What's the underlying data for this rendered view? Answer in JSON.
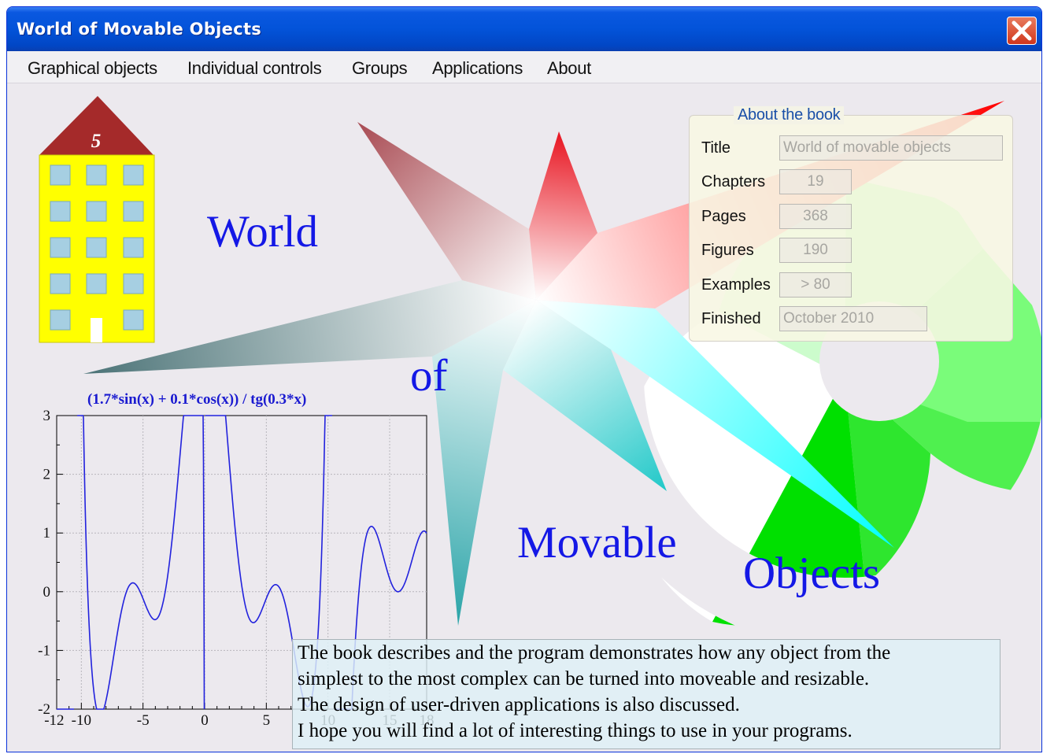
{
  "window": {
    "title": "World of Movable Objects"
  },
  "menu": [
    "Graphical objects",
    "Individual controls",
    "Groups",
    "Applications",
    "About"
  ],
  "building": {
    "floor_label": "5"
  },
  "words": {
    "w1": "World",
    "w2": "of",
    "w3": "Movable",
    "w4": "Objects"
  },
  "about": {
    "legend": "About the book",
    "title_label": "Title",
    "title_value": "World of movable objects",
    "chapters_label": "Chapters",
    "chapters_value": "19",
    "pages_label": "Pages",
    "pages_value": "368",
    "figures_label": "Figures",
    "figures_value": "190",
    "examples_label": "Examples",
    "examples_value": "> 80",
    "finished_label": "Finished",
    "finished_value": "October 2010"
  },
  "text_lines": [
    "The book describes and the program demonstrates how any object from the",
    "simplest to the most complex can be turned into moveable and resizable.",
    "The design of user-driven applications is also discussed.",
    "I hope you will find a lot of interesting things to use in your programs."
  ],
  "chart_data": {
    "type": "line",
    "title": "(1.7*sin(x) + 0.1*cos(x)) / tg(0.3*x)",
    "function": "(1.7*sin(x) + 0.1*cos(x)) / tg(0.3*x)",
    "xlim": [
      -12,
      18
    ],
    "ylim": [
      -2,
      3
    ],
    "x_ticks": [
      "-12",
      "-10",
      "-5",
      "0",
      "5",
      "10",
      "15",
      "18"
    ],
    "y_ticks": [
      "3",
      "2",
      "1",
      "0",
      "-1",
      "-2"
    ],
    "grid": true,
    "line_color": "#2222dd"
  },
  "colors": {
    "accent_blue": "#1418e6",
    "title_bar": "#0353d9",
    "building_yellow": "#ffff00",
    "building_roof": "#a52a2a",
    "window_blue": "#a6cfe2"
  }
}
